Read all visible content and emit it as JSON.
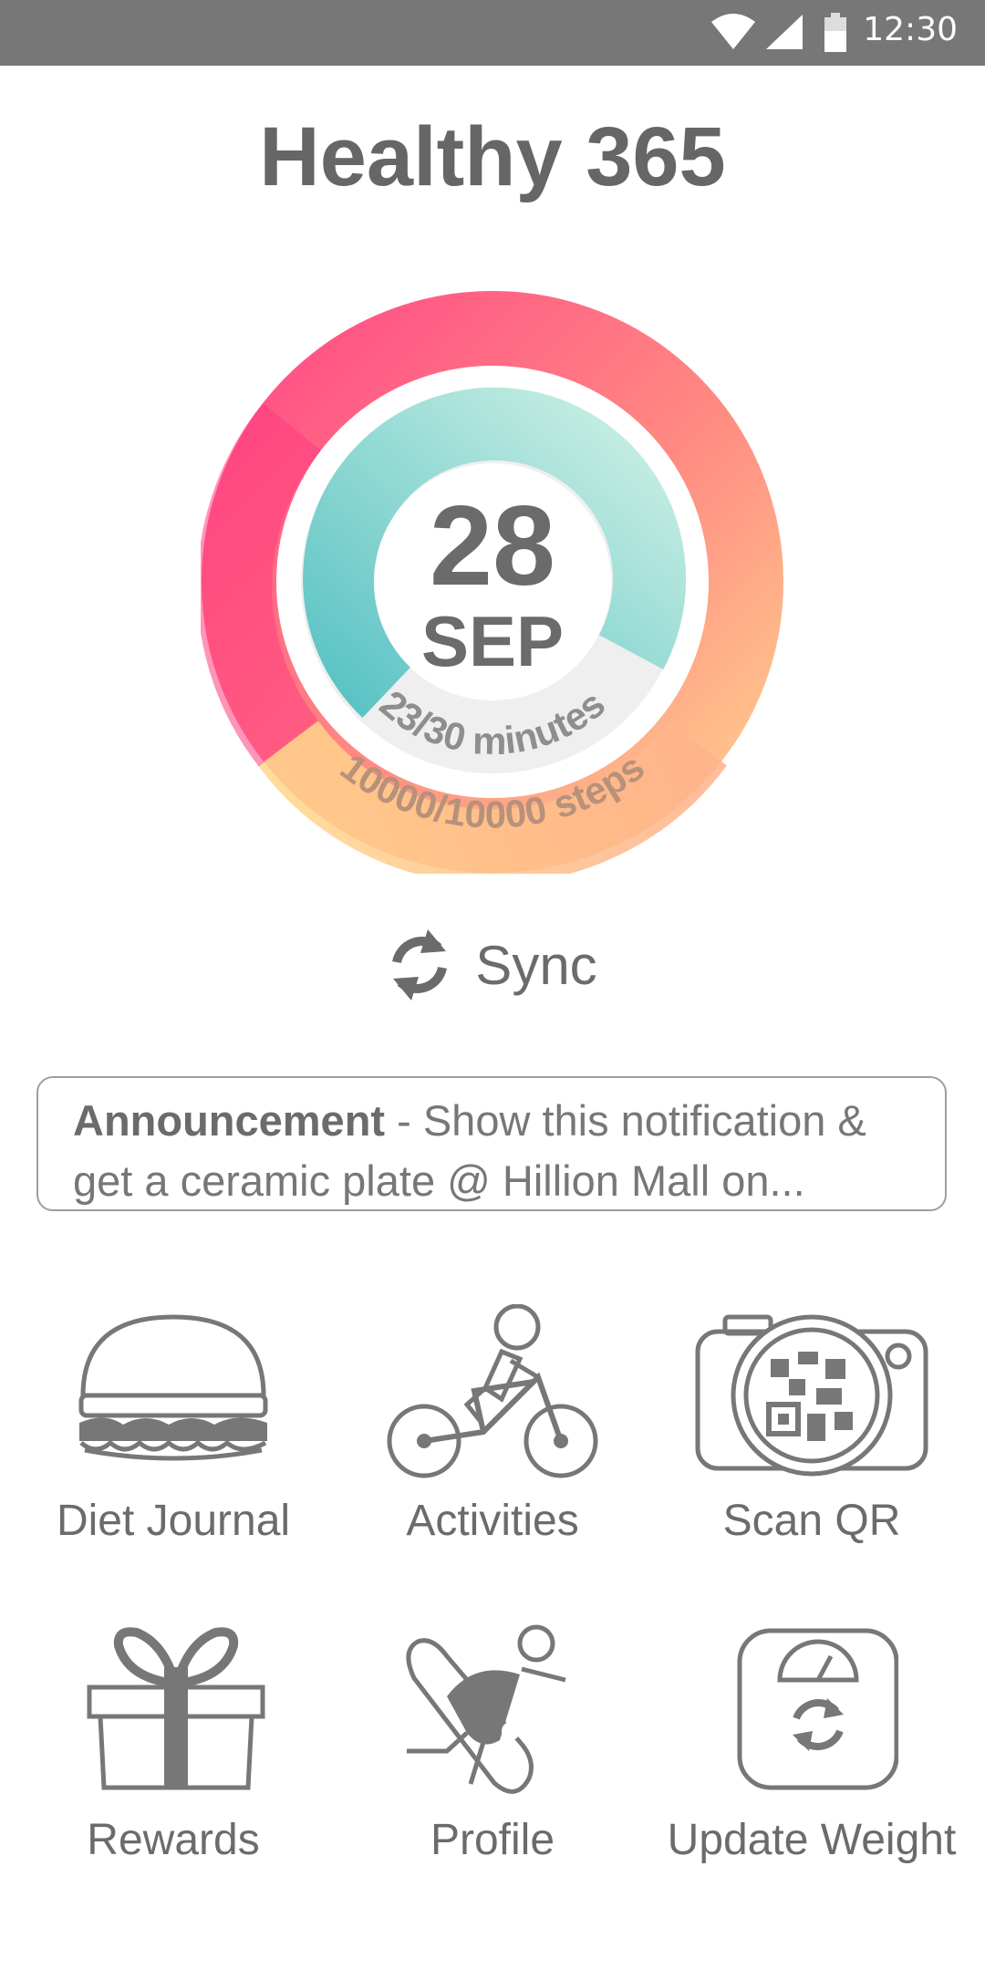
{
  "status_bar": {
    "time": "12:30"
  },
  "app": {
    "title": "Healthy 365"
  },
  "progress": {
    "day": "28",
    "month": "SEP",
    "minutes_text": "23/30 minutes",
    "steps_text": "10000/10000 steps",
    "minutes_fraction": 0.77,
    "steps_fraction": 1.0
  },
  "sync": {
    "label": "Sync"
  },
  "announcement": {
    "title": "Announcement",
    "text": " - Show this notification & get a ceramic plate @ Hillion Mall on..."
  },
  "menu": {
    "diet_journal": "Diet Journal",
    "activities": "Activities",
    "scan_qr": "Scan QR",
    "rewards": "Rewards",
    "profile": "Profile",
    "update_weight": "Update Weight"
  },
  "colors": {
    "status_bar": "#777777",
    "steps_ring_start": "#ff3c7f",
    "steps_ring_end": "#ffd08a",
    "minutes_ring_start": "#5ac4c4",
    "minutes_ring_end": "#c4eee2",
    "icon": "#777777"
  }
}
